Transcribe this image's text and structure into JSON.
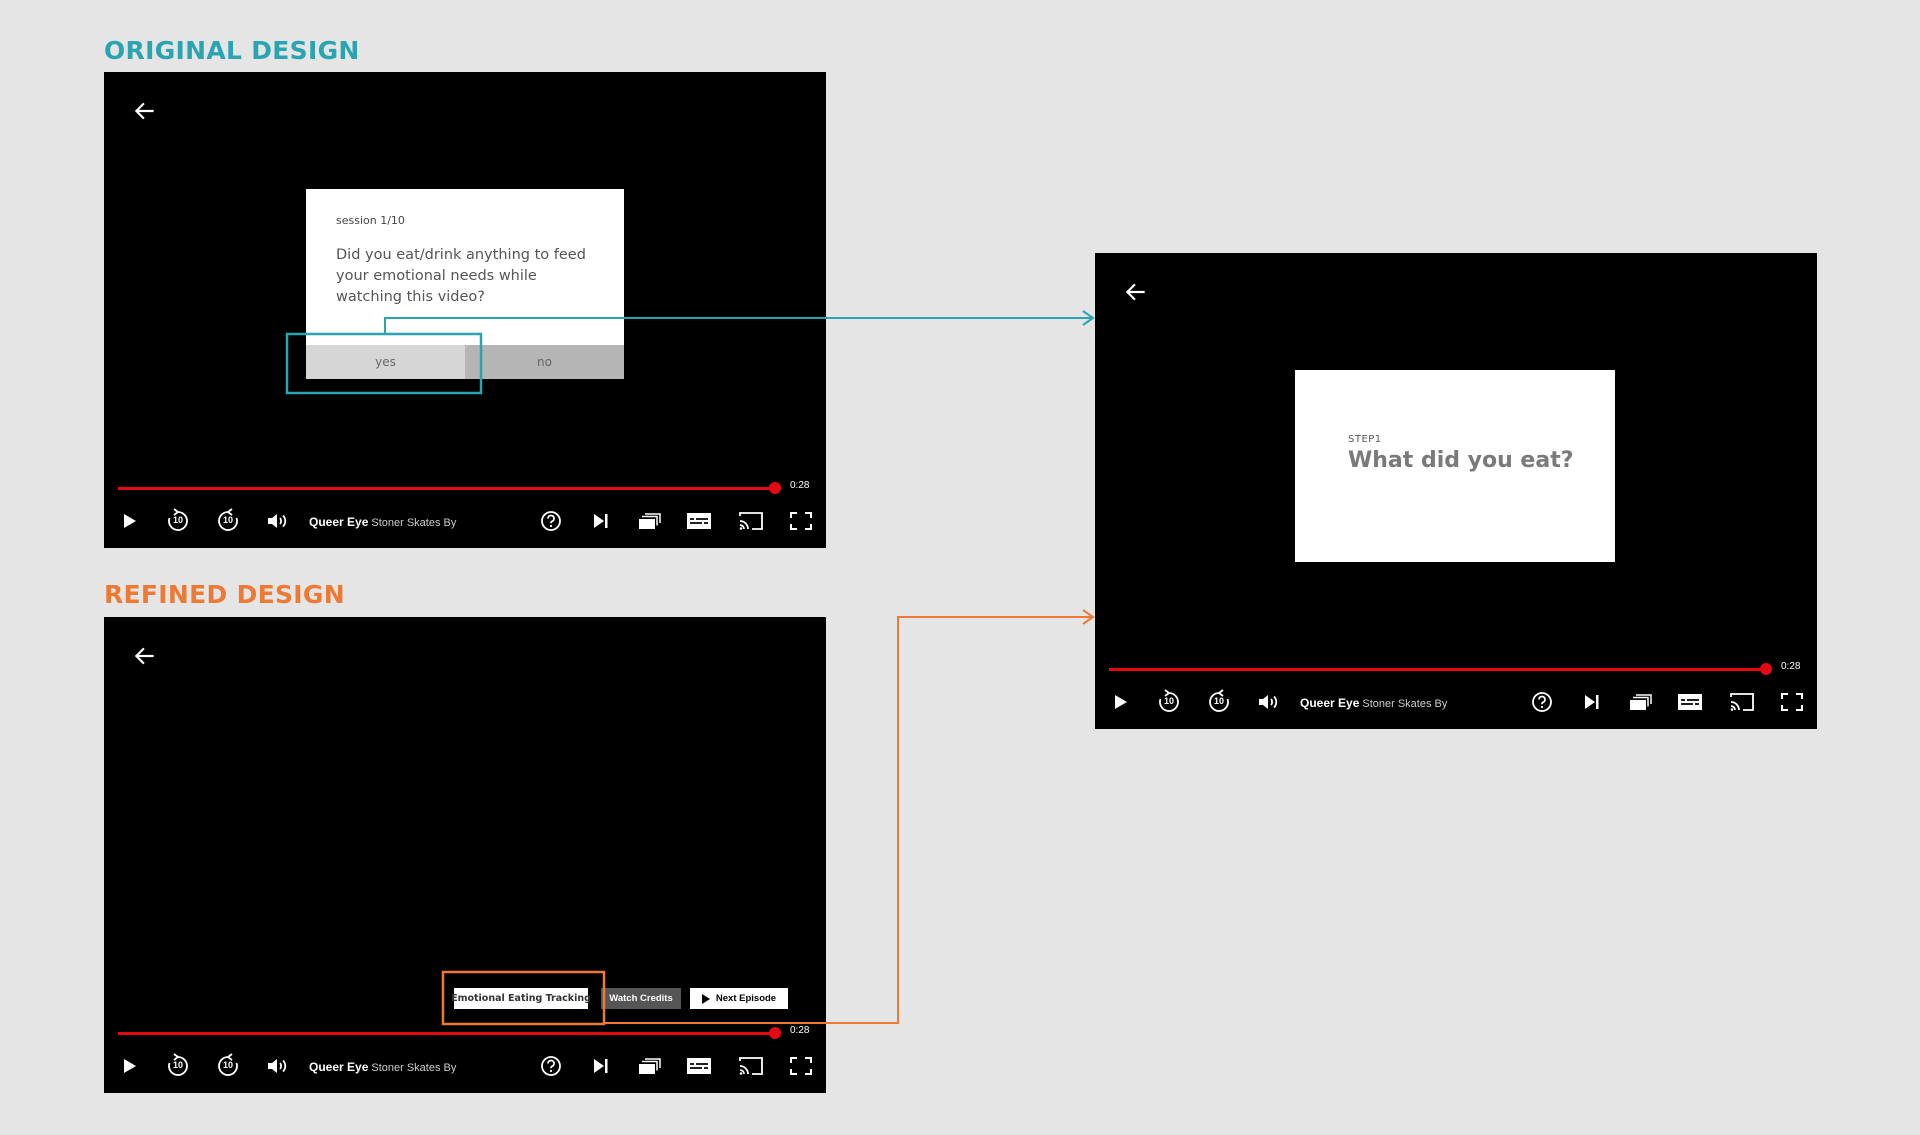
{
  "labels": {
    "original": "ORIGINAL DESIGN",
    "refined": "REFINED DESIGN"
  },
  "player": {
    "show": "Queer Eye",
    "episode": "Stoner Skates By",
    "time": "0:28",
    "rewind_label": "10",
    "forward_label": "10",
    "progress_fraction": 0.96
  },
  "original_dialog": {
    "session": "session 1/10",
    "question": "Did you eat/drink anything to feed your emotional needs while watching this video?",
    "yes": "yes",
    "no": "no"
  },
  "step": {
    "label": "STEP1",
    "title": "What did you eat?"
  },
  "refined_buttons": {
    "tracking": "Emotional Eating Tracking",
    "credits": "Watch Credits",
    "next": "Next Episode"
  },
  "colors": {
    "teal": "#2ba4b1",
    "orange": "#ec7a35",
    "progress": "#e50914",
    "background": "#e5e5e5"
  },
  "icons": [
    "back-arrow-icon",
    "play-icon",
    "rewind-10-icon",
    "forward-10-icon",
    "volume-icon",
    "help-icon",
    "next-episode-icon",
    "episodes-icon",
    "subtitles-icon",
    "cast-icon",
    "fullscreen-icon"
  ]
}
